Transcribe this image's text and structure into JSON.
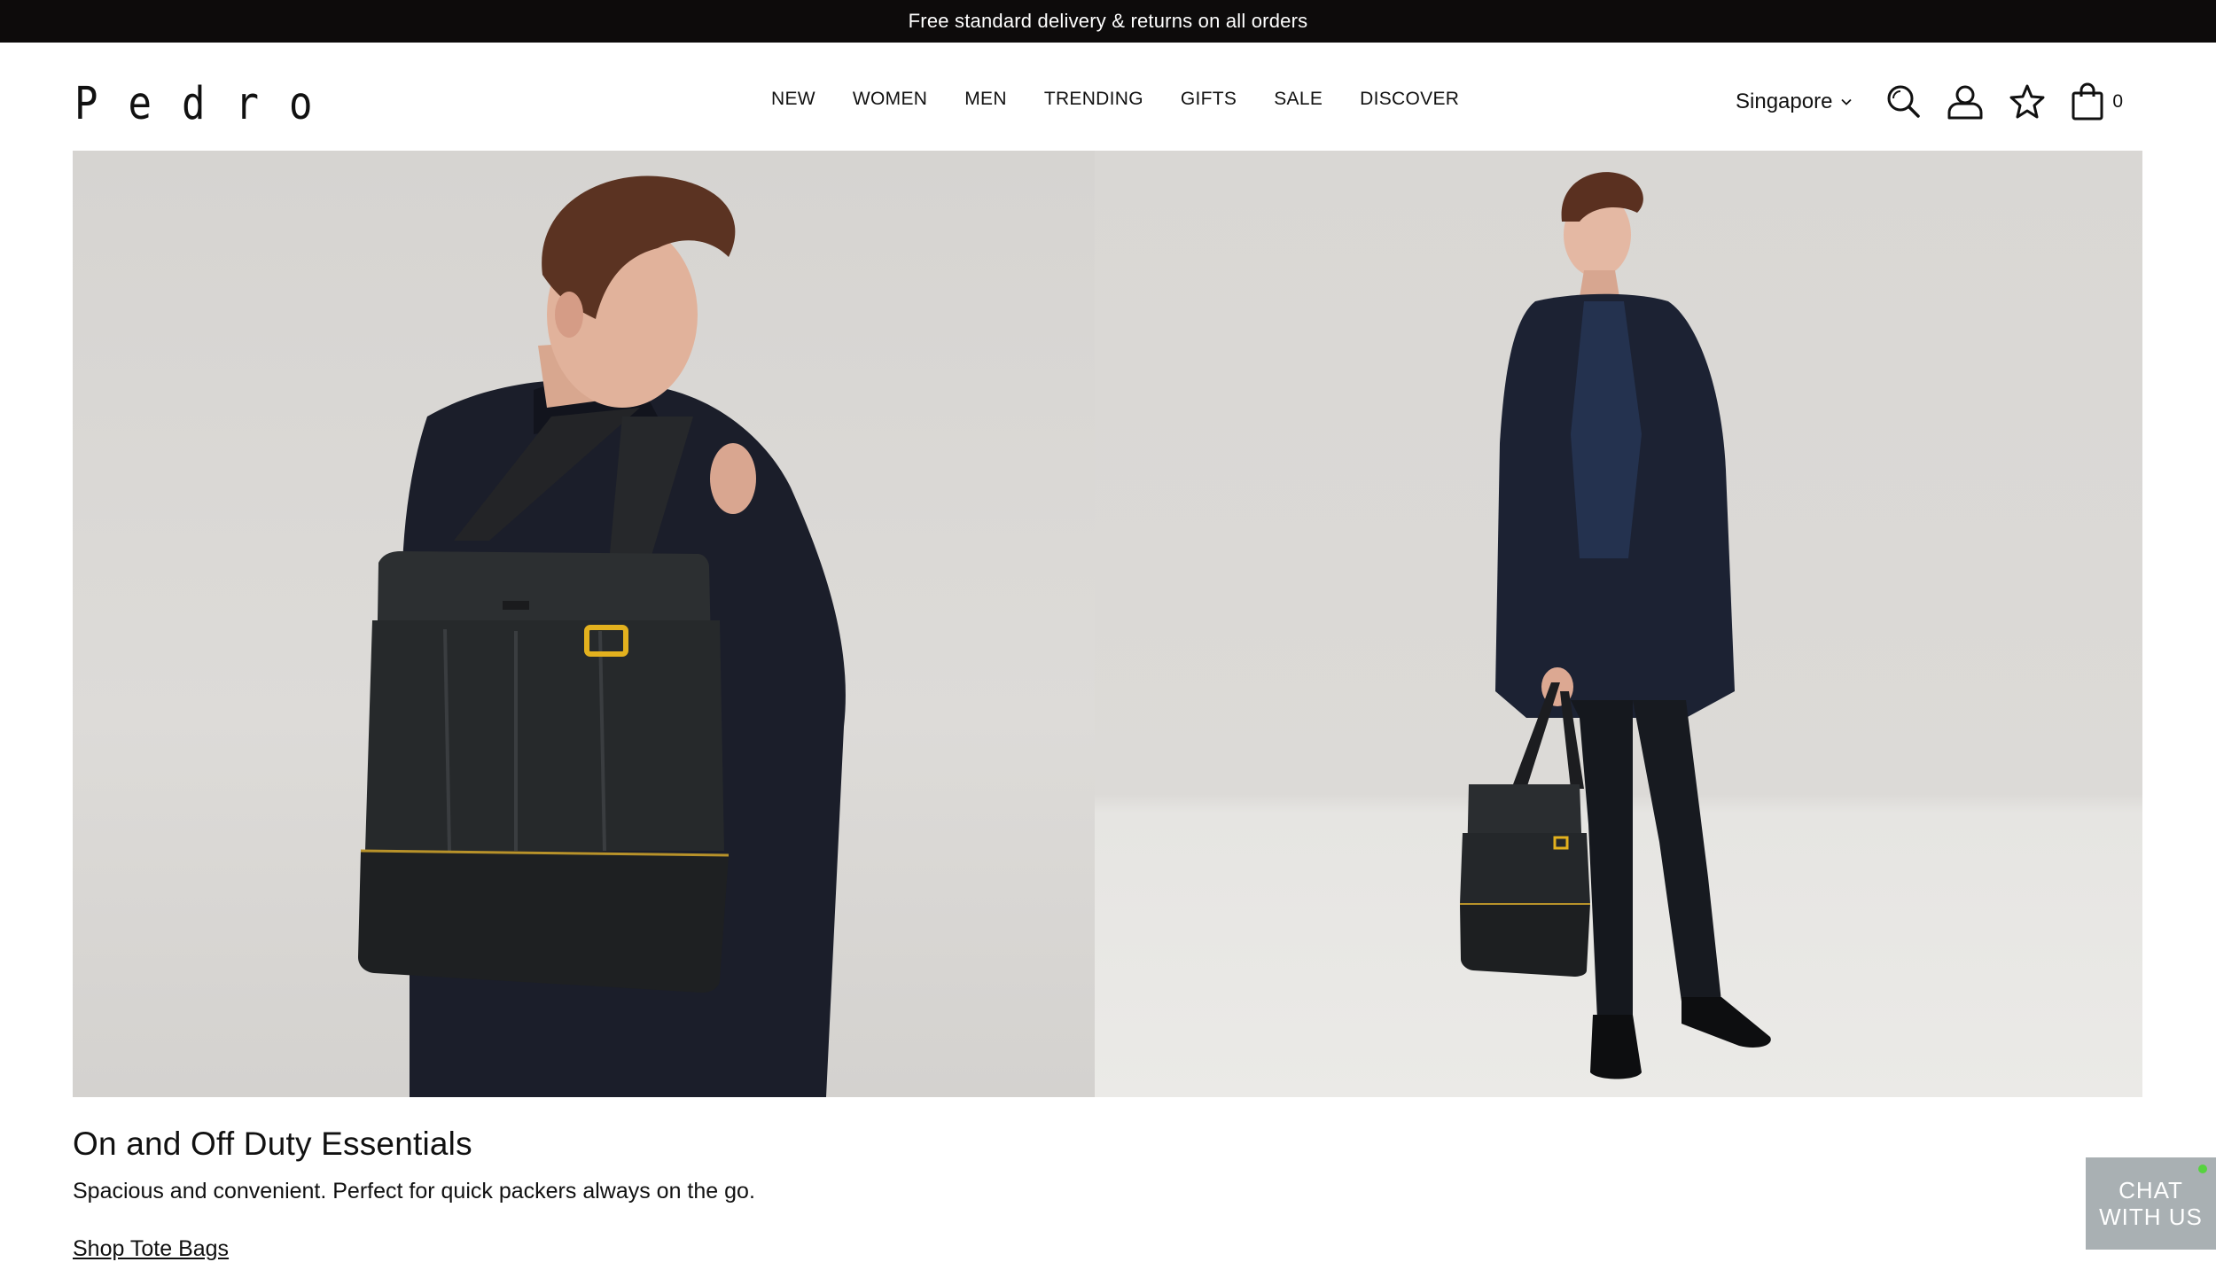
{
  "promo": {
    "text": "Free standard delivery & returns on all orders"
  },
  "header": {
    "logo_text": "Pedro",
    "nav": [
      {
        "label": "NEW"
      },
      {
        "label": "WOMEN"
      },
      {
        "label": "MEN"
      },
      {
        "label": "TRENDING"
      },
      {
        "label": "GIFTS"
      },
      {
        "label": "SALE"
      },
      {
        "label": "DISCOVER"
      }
    ],
    "region": "Singapore",
    "icons": [
      "search-icon",
      "account-icon",
      "wishlist-star-icon",
      "shopping-bag-icon"
    ],
    "bag_count": "0"
  },
  "hero": {
    "images": [
      "model-with-tote-bag-on-shoulder",
      "model-holding-tote-bag"
    ]
  },
  "content": {
    "title": "On and Off Duty Essentials",
    "description": "Spacious and convenient. Perfect for quick packers always on the go.",
    "cta": "Shop Tote Bags"
  },
  "chat": {
    "line1": "CHAT",
    "line2": "WITH US",
    "status_color": "#56d33f"
  },
  "colors": {
    "promo_bg": "#0d0b0b",
    "chat_bg": "#a9b0b3",
    "text": "#111111"
  }
}
